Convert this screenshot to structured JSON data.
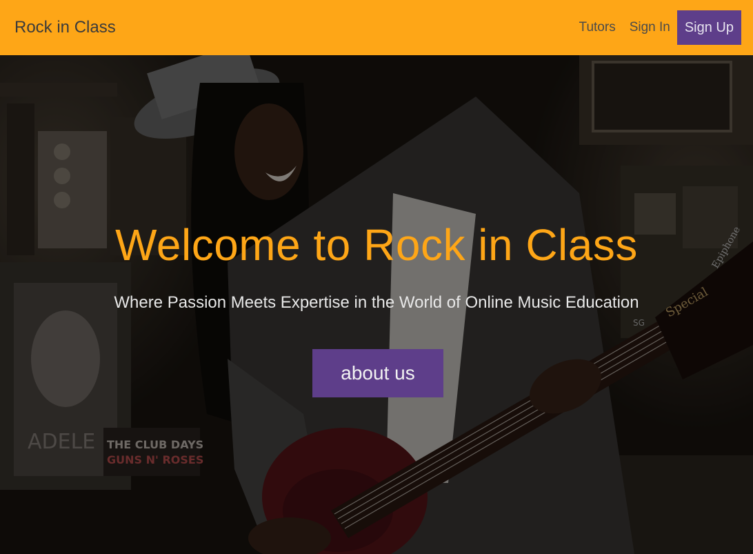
{
  "nav": {
    "brand": "Rock in Class",
    "links": [
      "Tutors",
      "Sign In"
    ],
    "signup": "Sign Up"
  },
  "hero": {
    "title": "Welcome to Rock in Class",
    "subtitle": "Where Passion Meets Expertise in the World of Online Music Education",
    "button": "about us",
    "background_image": "woman-playing-electric-guitar-in-record-store",
    "print_text": [
      "ADELE",
      "THE CLUB DAYS",
      "GUNS N' ROSES",
      "Epiphone",
      "Special",
      "SG"
    ]
  },
  "colors": {
    "nav_bg": "#fea617",
    "accent": "#fea617",
    "button_bg": "#5e3e8a"
  }
}
